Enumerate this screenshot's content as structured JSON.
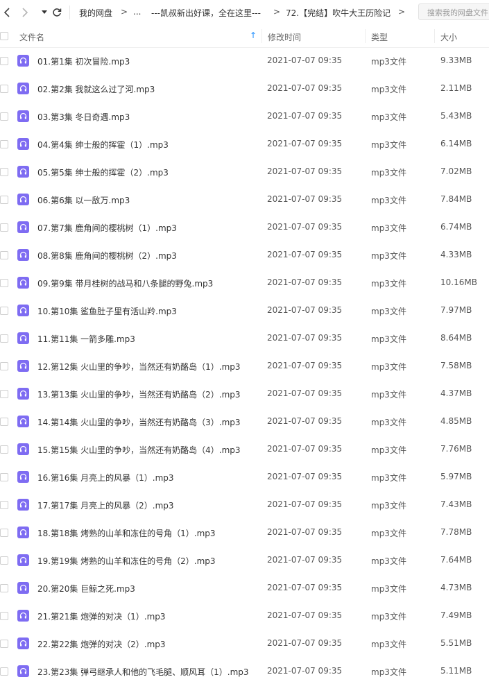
{
  "toolbar": {
    "breadcrumb": [
      {
        "label": "我的网盘"
      },
      {
        "label": "..."
      },
      {
        "label": "---凯叔新出好课，全在这里---"
      },
      {
        "label": "72.【完结】吹牛大王历险记"
      }
    ],
    "separator": ">",
    "search_placeholder": "搜索我的网盘文件"
  },
  "header": {
    "name": "文件名",
    "mtime": "修改时间",
    "type": "类型",
    "size": "大小",
    "sort_indicator": "↑"
  },
  "files": [
    {
      "name": "01.第1集 初次冒险.mp3",
      "mtime": "2021-07-07 09:35",
      "type": "mp3文件",
      "size": "9.33MB"
    },
    {
      "name": "02.第2集 我就这么过了河.mp3",
      "mtime": "2021-07-07 09:35",
      "type": "mp3文件",
      "size": "2.11MB"
    },
    {
      "name": "03.第3集 冬日奇遇.mp3",
      "mtime": "2021-07-07 09:35",
      "type": "mp3文件",
      "size": "5.43MB"
    },
    {
      "name": "04.第4集 绅士般的挥霍（1）.mp3",
      "mtime": "2021-07-07 09:35",
      "type": "mp3文件",
      "size": "6.14MB"
    },
    {
      "name": "05.第5集 绅士般的挥霍（2）.mp3",
      "mtime": "2021-07-07 09:35",
      "type": "mp3文件",
      "size": "7.02MB"
    },
    {
      "name": "06.第6集 以一敌万.mp3",
      "mtime": "2021-07-07 09:35",
      "type": "mp3文件",
      "size": "7.84MB"
    },
    {
      "name": "07.第7集 鹿角间的樱桃树（1）.mp3",
      "mtime": "2021-07-07 09:35",
      "type": "mp3文件",
      "size": "6.74MB"
    },
    {
      "name": "08.第8集 鹿角间的樱桃树（2）.mp3",
      "mtime": "2021-07-07 09:35",
      "type": "mp3文件",
      "size": "4.33MB"
    },
    {
      "name": "09.第9集 带月桂树的战马和八条腿的野兔.mp3",
      "mtime": "2021-07-07 09:35",
      "type": "mp3文件",
      "size": "10.16MB"
    },
    {
      "name": "10.第10集 鲨鱼肚子里有活山羚.mp3",
      "mtime": "2021-07-07 09:35",
      "type": "mp3文件",
      "size": "7.97MB"
    },
    {
      "name": "11.第11集 一箭多雕.mp3",
      "mtime": "2021-07-07 09:35",
      "type": "mp3文件",
      "size": "8.64MB"
    },
    {
      "name": "12.第12集 火山里的争吵，当然还有奶酪岛（1）.mp3",
      "mtime": "2021-07-07 09:35",
      "type": "mp3文件",
      "size": "7.58MB"
    },
    {
      "name": "13.第13集 火山里的争吵，当然还有奶酪岛（2）.mp3",
      "mtime": "2021-07-07 09:35",
      "type": "mp3文件",
      "size": "4.37MB"
    },
    {
      "name": "14.第14集 火山里的争吵，当然还有奶酪岛（3）.mp3",
      "mtime": "2021-07-07 09:35",
      "type": "mp3文件",
      "size": "4.85MB"
    },
    {
      "name": "15.第15集 火山里的争吵，当然还有奶酪岛（4）.mp3",
      "mtime": "2021-07-07 09:35",
      "type": "mp3文件",
      "size": "7.76MB"
    },
    {
      "name": "16.第16集 月亮上的风暴（1）.mp3",
      "mtime": "2021-07-07 09:35",
      "type": "mp3文件",
      "size": "5.97MB"
    },
    {
      "name": "17.第17集 月亮上的风暴（2）.mp3",
      "mtime": "2021-07-07 09:35",
      "type": "mp3文件",
      "size": "7.43MB"
    },
    {
      "name": "18.第18集 烤熟的山羊和冻住的号角（1）.mp3",
      "mtime": "2021-07-07 09:35",
      "type": "mp3文件",
      "size": "7.78MB"
    },
    {
      "name": "19.第19集 烤熟的山羊和冻住的号角（2）.mp3",
      "mtime": "2021-07-07 09:35",
      "type": "mp3文件",
      "size": "7.64MB"
    },
    {
      "name": "20.第20集 巨鲸之死.mp3",
      "mtime": "2021-07-07 09:35",
      "type": "mp3文件",
      "size": "4.73MB"
    },
    {
      "name": "21.第21集 炮弹的对决（1）.mp3",
      "mtime": "2021-07-07 09:35",
      "type": "mp3文件",
      "size": "7.49MB"
    },
    {
      "name": "22.第22集 炮弹的对决（2）.mp3",
      "mtime": "2021-07-07 09:35",
      "type": "mp3文件",
      "size": "5.51MB"
    },
    {
      "name": "23.第23集 弹弓继承人和他的飞毛腿、顺风耳（1）.mp3",
      "mtime": "2021-07-07 09:35",
      "type": "mp3文件",
      "size": "5.11MB"
    }
  ],
  "colors": {
    "accent": "#1a8cff",
    "audio_icon": "#7e6cf2"
  },
  "icons": {
    "back": "chevron-left-icon",
    "forward": "chevron-right-icon",
    "history": "caret-down-icon",
    "refresh": "refresh-icon",
    "file": "headphones-icon"
  }
}
